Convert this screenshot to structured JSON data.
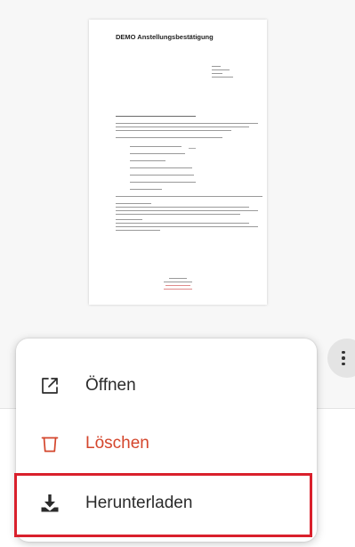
{
  "document_preview": {
    "title": "DEMO Anstellungsbestätigung"
  },
  "more_button": {
    "icon": "more-vertical-icon"
  },
  "menu": {
    "items": [
      {
        "label": "Öffnen",
        "icon": "open-external-icon",
        "color": "#2b2b2b"
      },
      {
        "label": "Löschen",
        "icon": "trash-icon",
        "color": "#d4462c"
      },
      {
        "label": "Herunterladen",
        "icon": "download-icon",
        "color": "#2b2b2b"
      }
    ]
  },
  "colors": {
    "danger": "#d4462c",
    "highlight": "#d9202c"
  }
}
